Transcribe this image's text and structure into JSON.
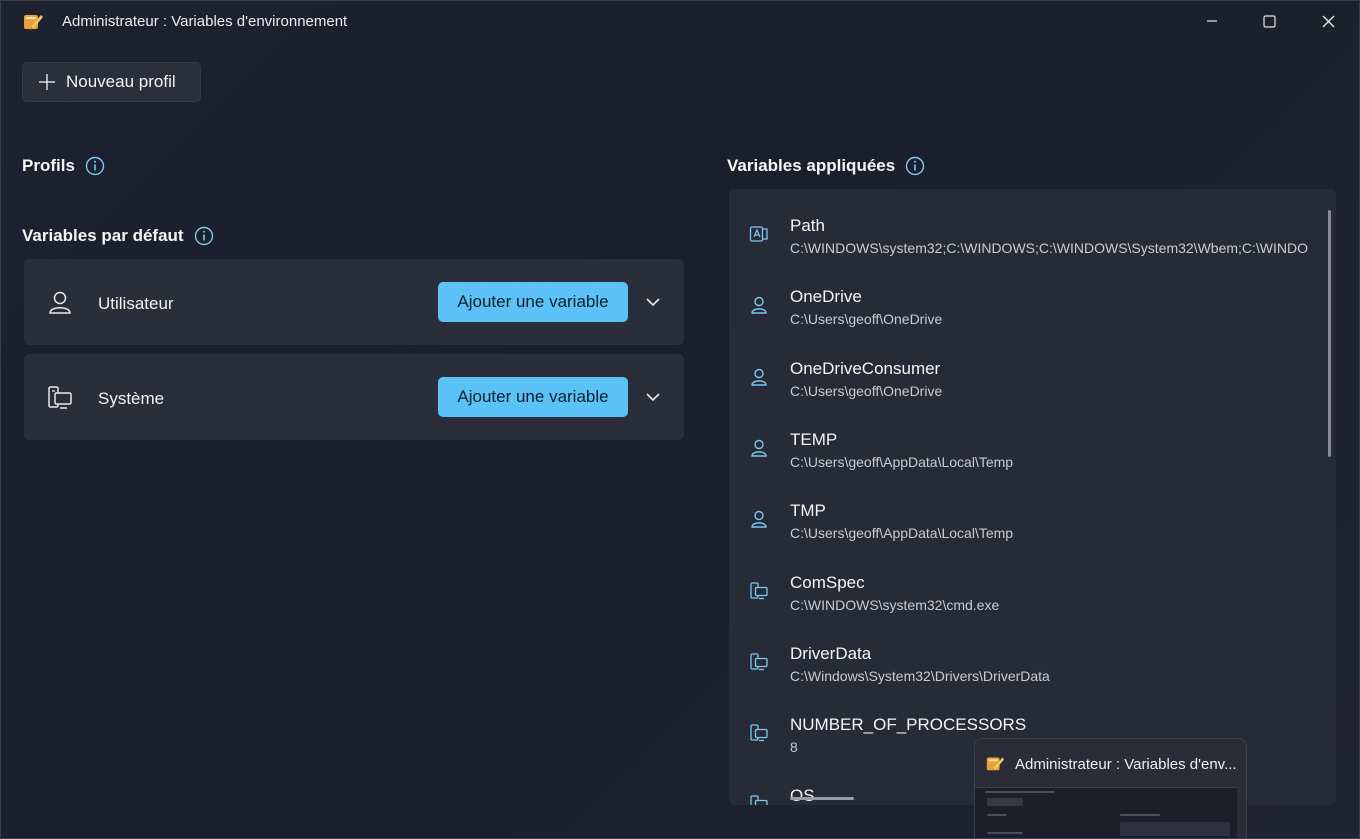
{
  "window": {
    "title": "Administrateur : Variables d'environnement"
  },
  "toolbar": {
    "new_profile_label": "Nouveau profil"
  },
  "profiles": {
    "heading": "Profils"
  },
  "defaults": {
    "heading": "Variables par défaut",
    "cards": [
      {
        "label": "Utilisateur",
        "icon": "user-icon",
        "button_label": "Ajouter une variable"
      },
      {
        "label": "Système",
        "icon": "system-icon",
        "button_label": "Ajouter une variable"
      }
    ]
  },
  "applied": {
    "heading": "Variables appliquées",
    "rows": [
      {
        "name": "Path",
        "value": "C:\\WINDOWS\\system32;C:\\WINDOWS;C:\\WINDOWS\\System32\\Wbem;C:\\WINDO",
        "icon": "path-edit-icon"
      },
      {
        "name": "OneDrive",
        "value": "C:\\Users\\geoff\\OneDrive",
        "icon": "user-icon"
      },
      {
        "name": "OneDriveConsumer",
        "value": "C:\\Users\\geoff\\OneDrive",
        "icon": "user-icon"
      },
      {
        "name": "TEMP",
        "value": "C:\\Users\\geoff\\AppData\\Local\\Temp",
        "icon": "user-icon"
      },
      {
        "name": "TMP",
        "value": "C:\\Users\\geoff\\AppData\\Local\\Temp",
        "icon": "user-icon"
      },
      {
        "name": "ComSpec",
        "value": "C:\\WINDOWS\\system32\\cmd.exe",
        "icon": "system-icon"
      },
      {
        "name": "DriverData",
        "value": "C:\\Windows\\System32\\Drivers\\DriverData",
        "icon": "system-icon"
      },
      {
        "name": "NUMBER_OF_PROCESSORS",
        "value": "8",
        "icon": "system-icon"
      },
      {
        "name": "OS",
        "value": "",
        "icon": "system-icon"
      }
    ]
  },
  "thumbnail": {
    "title": "Administrateur : Variables d'env..."
  },
  "colors": {
    "accent": "#5bc2f7",
    "icon_accent": "#7cc8ee"
  }
}
